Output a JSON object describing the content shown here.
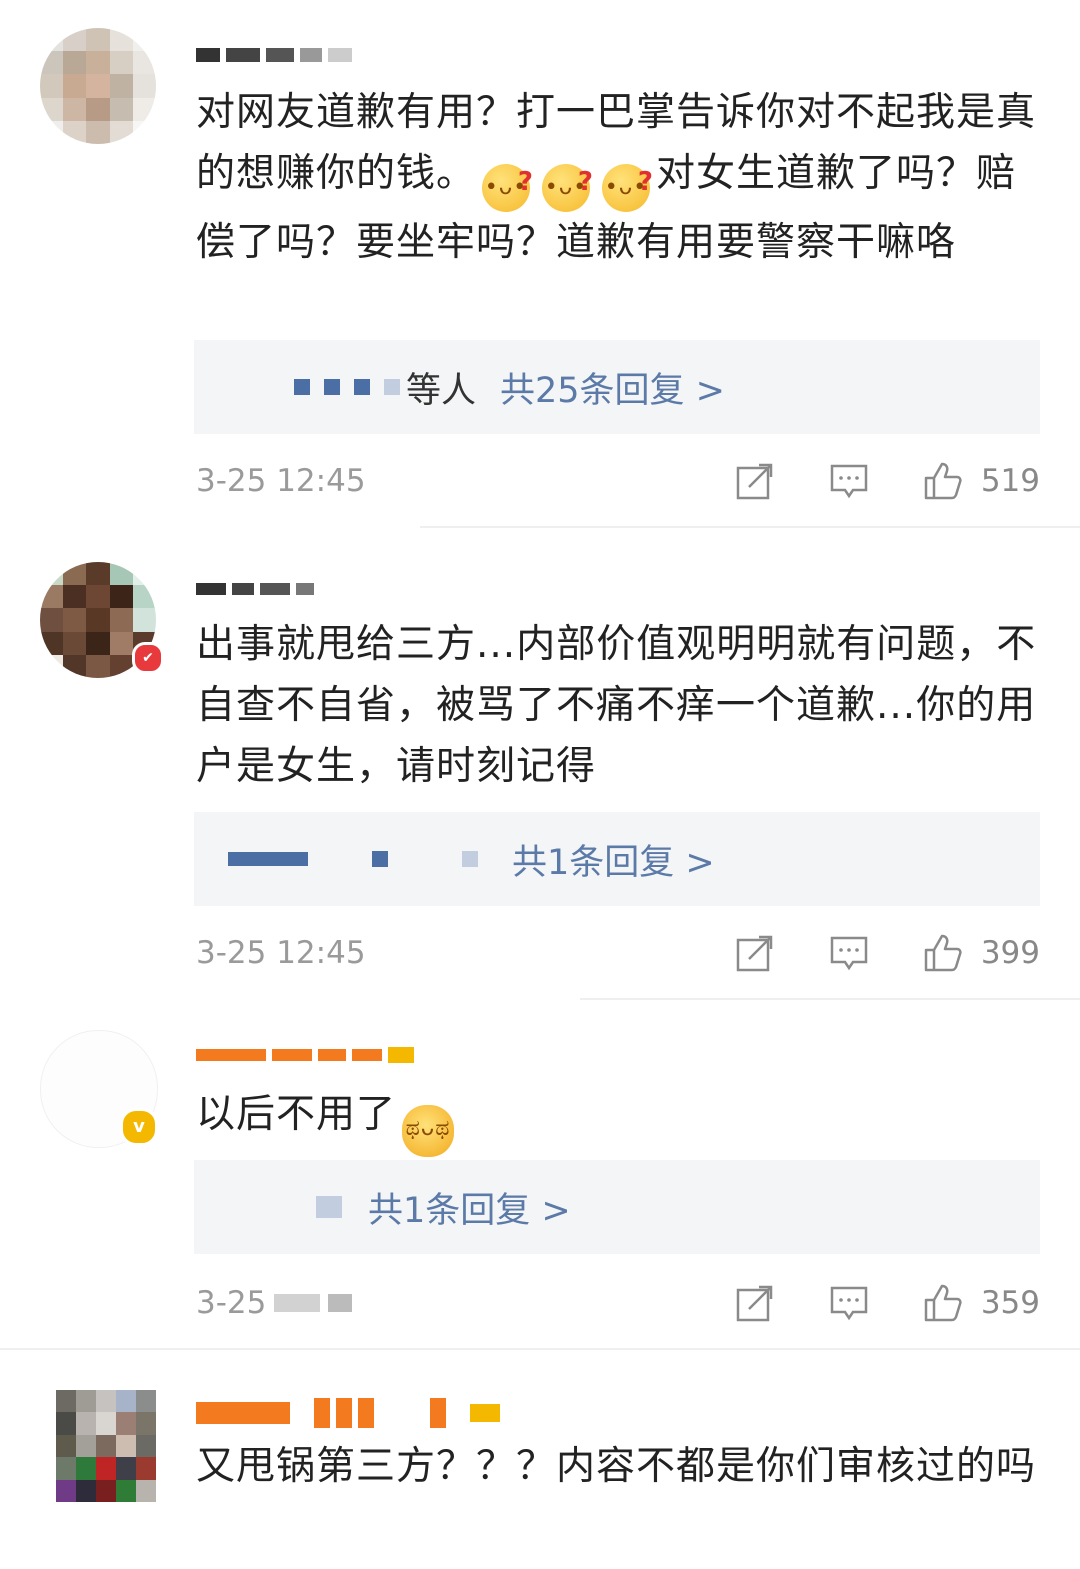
{
  "comments": [
    {
      "content_parts": [
        "对网友道歉有用？打一巴掌告诉你对不起我是真的想赚你的钱。",
        "对女生道歉了吗？赔偿了吗？要坐牢吗？道歉有用要警察干嘛咯"
      ],
      "emoji_icon": "confused-face-emoji",
      "reply_etc": "等人",
      "reply_count": "共25条回复 >",
      "time": "3-25 12:45",
      "likes": "519"
    },
    {
      "content": "出事就甩给三方...内部价值观明明就有问题，不自查不自省，被骂了不痛不痒一个道歉...你的用户是女生，请时刻记得",
      "reply_count": "共1条回复 >",
      "time": "3-25 12:45",
      "likes": "399"
    },
    {
      "content": "以后不用了",
      "emoji_icon": "crying-face-emoji",
      "verified_icon": "v",
      "reply_count": "共1条回复 >",
      "time": "3-25",
      "likes": "359"
    },
    {
      "content": "又甩锅第三方？？？内容不都是你们审核过的吗"
    }
  ],
  "colors": {
    "reply_link": "#5b7aa7",
    "vip_name": "#f47a20",
    "verified": "#f5b800",
    "meta_text": "#9a9a9a"
  }
}
